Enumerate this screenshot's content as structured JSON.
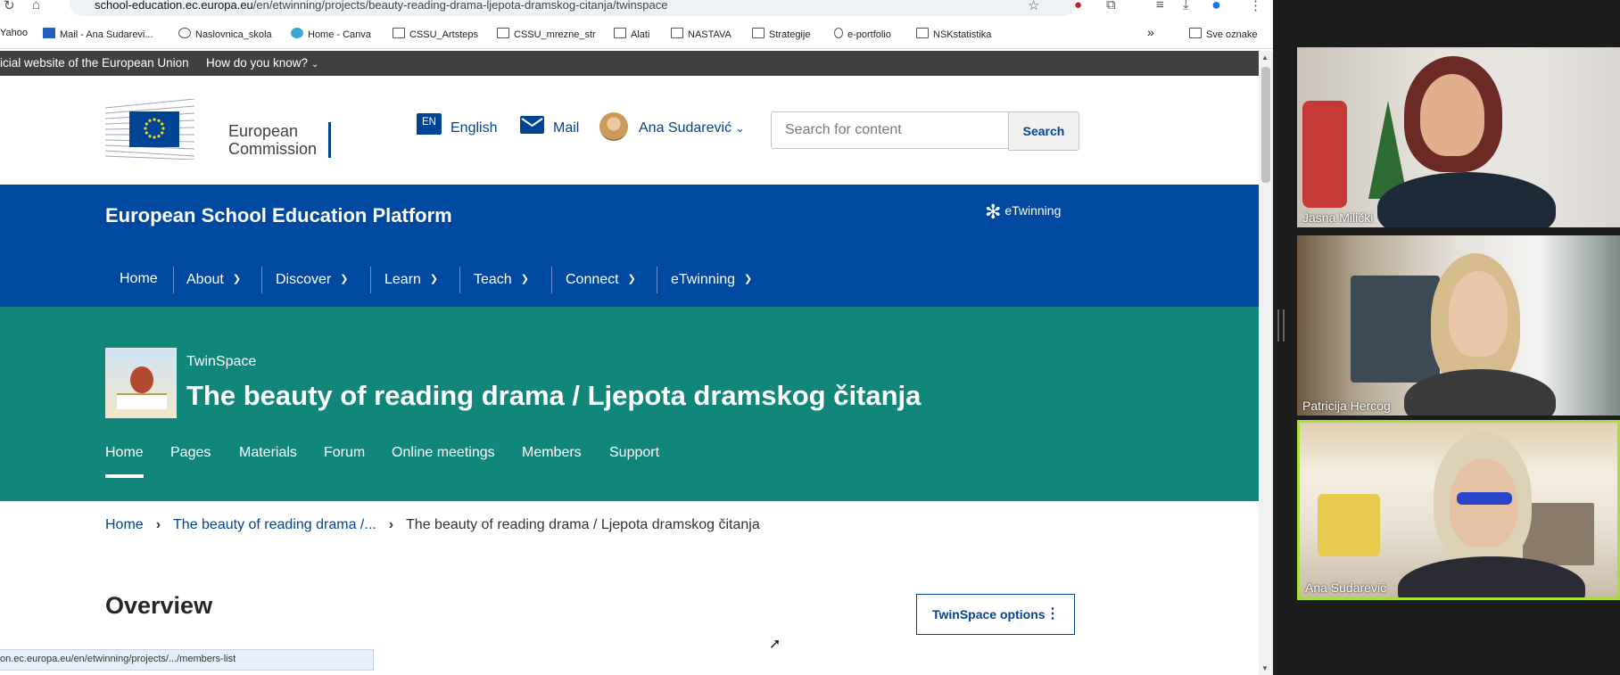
{
  "browser": {
    "url_domain": "school-education.ec.europa.eu",
    "url_path": "/en/etwinning/projects/beauty-reading-drama-ljepota-dramskog-citanja/twinspace",
    "bookmarks": [
      "Yahoo",
      "Mail - Ana Sudarevi...",
      "Naslovnica_skola",
      "Home - Canva",
      "CSSU_Artsteps",
      "CSSU_mrezne_str",
      "Alati",
      "NASTAVA",
      "Strategije",
      "e-portfolio",
      "NSKstatistika"
    ],
    "bookmarks_more": "»",
    "all_bookmarks": "Sve oznake",
    "status_url": "on.ec.europa.eu/en/etwinning/projects/.../members-list"
  },
  "eubar": {
    "text": "icial website of the European Union",
    "how": "How do you know?"
  },
  "header": {
    "logo_line1": "European",
    "logo_line2": "Commission",
    "lang_code": "EN",
    "lang_label": "English",
    "mail_label": "Mail",
    "user_name": "Ana Sudarević",
    "search_placeholder": "Search for content",
    "search_button": "Search"
  },
  "platform": {
    "title": "European School Education Platform",
    "etwinning_logo": "eTwinning",
    "nav": [
      "Home",
      "About",
      "Discover",
      "Learn",
      "Teach",
      "Connect",
      "eTwinning"
    ]
  },
  "twinspace": {
    "label": "TwinSpace",
    "title": "The beauty of reading drama / Ljepota dramskog čitanja",
    "subnav": [
      "Home",
      "Pages",
      "Materials",
      "Forum",
      "Online meetings",
      "Members",
      "Support"
    ]
  },
  "breadcrumb": {
    "home": "Home",
    "parent": "The beauty of reading drama /...",
    "current": "The beauty of reading drama / Ljepota dramskog čitanja"
  },
  "content": {
    "heading": "Overview",
    "options_button": "TwinSpace options"
  },
  "video": {
    "participants": [
      "Jasna Milički",
      "Patricija Hercog",
      "Ana Sudarević"
    ],
    "active_speaker": "Ana Sudarević",
    "active_color": "#a8dd3c"
  },
  "colors": {
    "ec_blue": "#004494",
    "platform_blue": "#0049a0",
    "twinspace_teal": "#10877a",
    "eubar": "#404040"
  }
}
